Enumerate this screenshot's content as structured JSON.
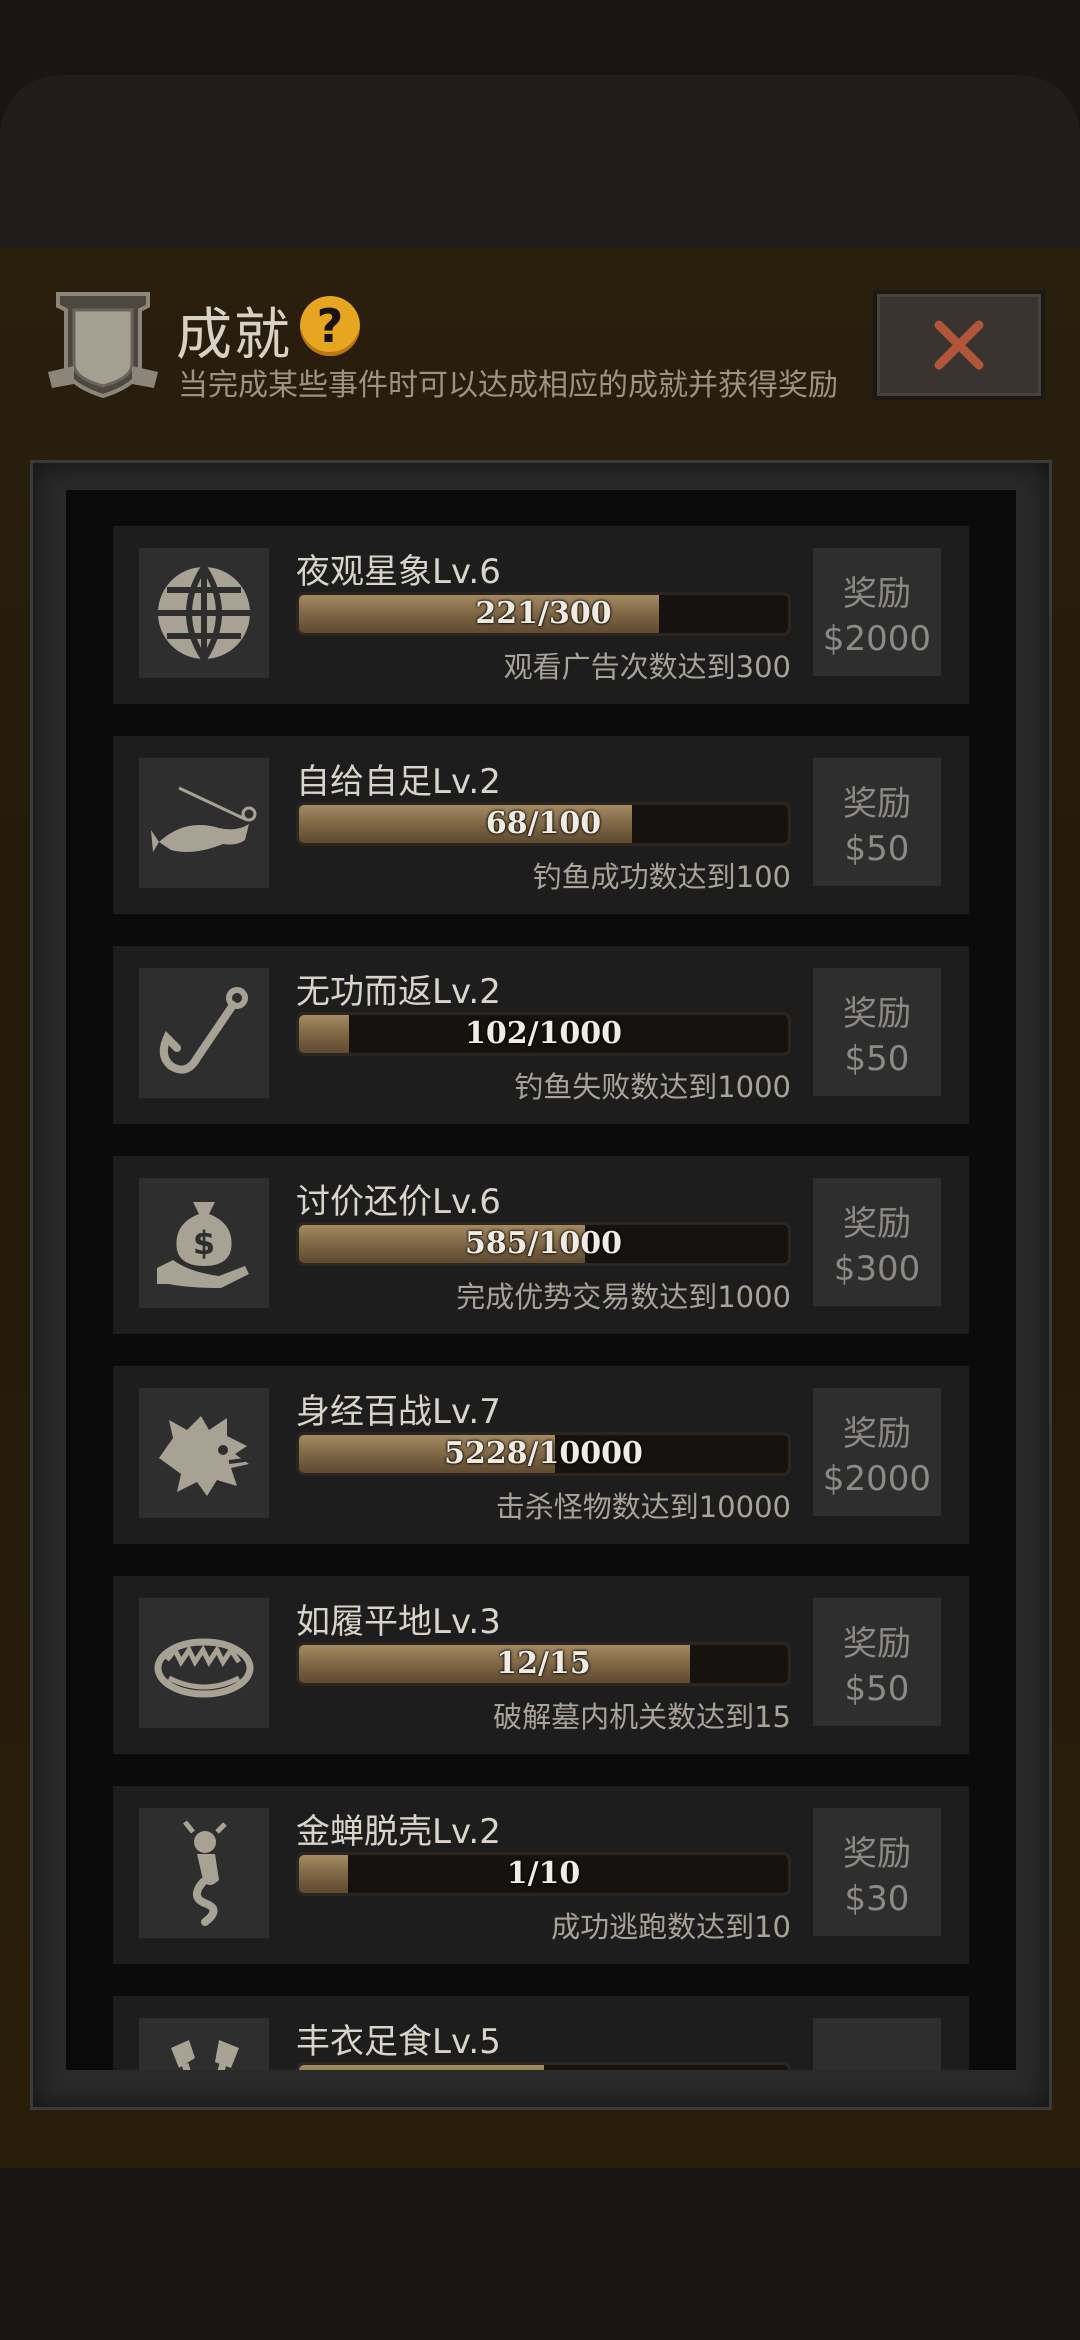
{
  "header": {
    "title": "成就",
    "help_glyph": "?",
    "subtitle": "当完成某些事件时可以达成相应的成就并获得奖励",
    "close_icon": "close-x-icon"
  },
  "colors": {
    "panel_bg": "#2a1f0d",
    "help_badge": "#e8a521",
    "close_x": "#b2563a",
    "bar_fill": "#8a7050"
  },
  "achievements": [
    {
      "name": "夜观星象Lv.6",
      "progress_text": "221/300",
      "progress": 0.737,
      "desc": "观看广告次数达到300",
      "reward_label": "奖励",
      "reward": "$2000",
      "icon": "globe-icon"
    },
    {
      "name": "自给自足Lv.2",
      "progress_text": "68/100",
      "progress": 0.68,
      "desc": "钓鱼成功数达到100",
      "reward_label": "奖励",
      "reward": "$50",
      "icon": "fish-icon"
    },
    {
      "name": "无功而返Lv.2",
      "progress_text": "102/1000",
      "progress": 0.102,
      "desc": "钓鱼失败数达到1000",
      "reward_label": "奖励",
      "reward": "$50",
      "icon": "fishhook-icon"
    },
    {
      "name": "讨价还价Lv.6",
      "progress_text": "585/1000",
      "progress": 0.585,
      "desc": "完成优势交易数达到1000",
      "reward_label": "奖励",
      "reward": "$300",
      "icon": "money-bag-hand-icon"
    },
    {
      "name": "身经百战Lv.7",
      "progress_text": "5228/10000",
      "progress": 0.5228,
      "desc": "击杀怪物数达到10000",
      "reward_label": "奖励",
      "reward": "$2000",
      "icon": "wolf-head-icon"
    },
    {
      "name": "如履平地Lv.3",
      "progress_text": "12/15",
      "progress": 0.8,
      "desc": "破解墓内机关数达到15",
      "reward_label": "奖励",
      "reward": "$50",
      "icon": "bear-trap-icon"
    },
    {
      "name": "金蝉脱壳Lv.2",
      "progress_text": "1/10",
      "progress": 0.1,
      "desc": "成功逃跑数达到10",
      "reward_label": "奖励",
      "reward": "$30",
      "icon": "escaping-figure-icon"
    },
    {
      "name": "丰衣足食Lv.5",
      "progress_text": "",
      "progress": 0.5,
      "desc": "",
      "reward_label": "",
      "reward": "",
      "icon": "cutlery-icon"
    }
  ]
}
